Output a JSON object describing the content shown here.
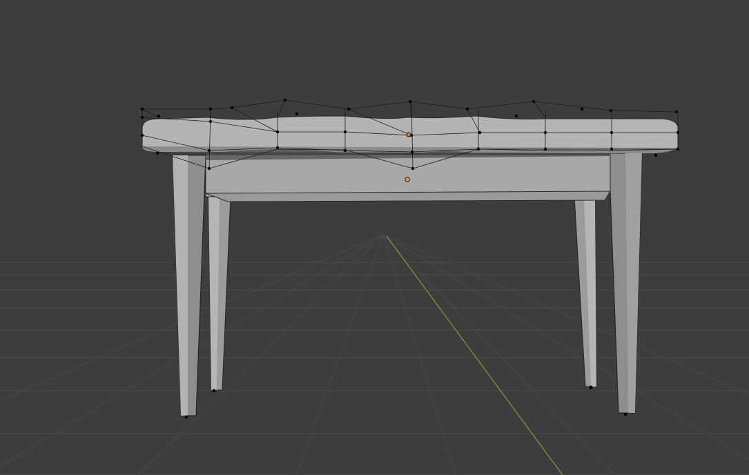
{
  "viewport": {
    "background_color": "#3d3d3d",
    "grid_color": "#4a4a4a",
    "y_axis_color": "#6b8f3a",
    "mesh_face_color": "#a8a8a8",
    "mesh_shadow_color": "#7e7e7e",
    "mesh_highlight_color": "#bcbcbc",
    "cage_wire_color": "#1a1a1a",
    "vertex_color": "#000000",
    "origin_color": "#e0702a",
    "selected_origin_color": "#e0702a"
  },
  "scene": {
    "object": "table-mesh",
    "modifier_cage": "subdivision-cage",
    "objects_visible": [
      "table-top",
      "table-apron",
      "table-legs"
    ]
  }
}
